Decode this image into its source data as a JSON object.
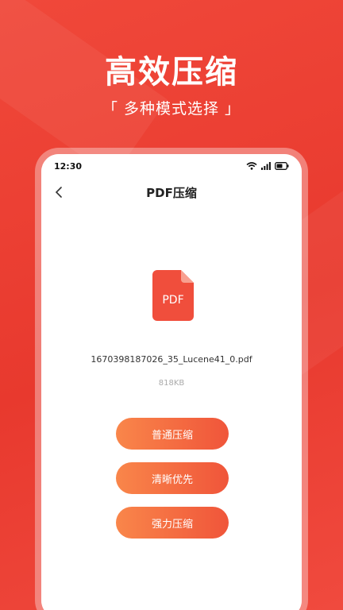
{
  "promo": {
    "headline": "高效压缩",
    "subline": "「 多种模式选择 」"
  },
  "status_bar": {
    "time": "12:30",
    "icons": [
      "wifi-icon",
      "signal-icon",
      "battery-icon"
    ]
  },
  "nav": {
    "back_icon": "chevron-left-icon",
    "title": "PDF压缩"
  },
  "file": {
    "icon_label": "PDF",
    "name": "1670398187026_35_Lucene41_0.pdf",
    "size": "818KB"
  },
  "modes": [
    {
      "label": "普通压缩"
    },
    {
      "label": "清晰优先"
    },
    {
      "label": "强力压缩"
    }
  ],
  "colors": {
    "background": "#e8392e",
    "file_icon": "#f04e3c",
    "button_start": "#f9864a",
    "button_end": "#f0553a"
  }
}
